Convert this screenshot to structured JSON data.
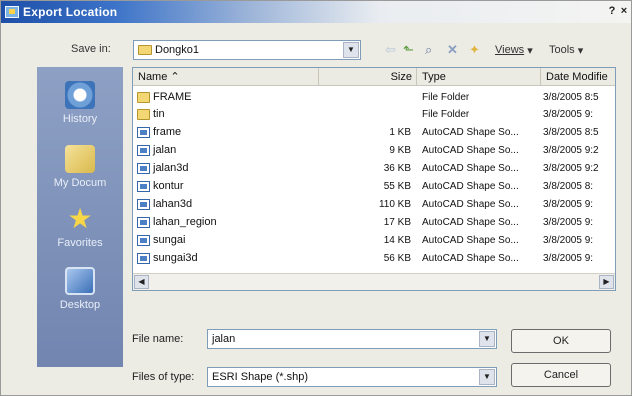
{
  "window": {
    "title": "Export Location",
    "help_label": "?",
    "close_label": "×"
  },
  "toolbar": {
    "save_in_label": "Save in:",
    "save_in_value": "Dongko1",
    "views_label": "Views",
    "tools_label": "Tools"
  },
  "icons": {
    "back": "back-arrow-icon",
    "up": "up-folder-icon",
    "search": "search-web-icon",
    "delete": "delete-icon",
    "new_folder": "new-folder-icon"
  },
  "places": [
    {
      "label": "History",
      "icon": "history-icon"
    },
    {
      "label": "My Docum",
      "icon": "my-documents-icon"
    },
    {
      "label": "Favorites",
      "icon": "favorites-icon"
    },
    {
      "label": "Desktop",
      "icon": "desktop-icon"
    }
  ],
  "columns": {
    "name": "Name",
    "size": "Size",
    "type": "Type",
    "date": "Date Modifie"
  },
  "files": [
    {
      "name": "FRAME",
      "size": "",
      "type": "File Folder",
      "date": "3/8/2005 8:5",
      "kind": "folder"
    },
    {
      "name": "tin",
      "size": "",
      "type": "File Folder",
      "date": "3/8/2005 9:",
      "kind": "folder"
    },
    {
      "name": "frame",
      "size": "1 KB",
      "type": "AutoCAD Shape So...",
      "date": "3/8/2005 8:5",
      "kind": "shape"
    },
    {
      "name": "jalan",
      "size": "9 KB",
      "type": "AutoCAD Shape So...",
      "date": "3/8/2005 9:2",
      "kind": "shape"
    },
    {
      "name": "jalan3d",
      "size": "36 KB",
      "type": "AutoCAD Shape So...",
      "date": "3/8/2005 9:2",
      "kind": "shape"
    },
    {
      "name": "kontur",
      "size": "55 KB",
      "type": "AutoCAD Shape So...",
      "date": "3/8/2005 8:",
      "kind": "shape"
    },
    {
      "name": "lahan3d",
      "size": "110 KB",
      "type": "AutoCAD Shape So...",
      "date": "3/8/2005 9:",
      "kind": "shape"
    },
    {
      "name": "lahan_region",
      "size": "17 KB",
      "type": "AutoCAD Shape So...",
      "date": "3/8/2005 9:",
      "kind": "shape"
    },
    {
      "name": "sungai",
      "size": "14 KB",
      "type": "AutoCAD Shape So...",
      "date": "3/8/2005 9:",
      "kind": "shape"
    },
    {
      "name": "sungai3d",
      "size": "56 KB",
      "type": "AutoCAD Shape So...",
      "date": "3/8/2005 9:",
      "kind": "shape"
    }
  ],
  "form": {
    "file_name_label": "File name:",
    "file_name_value": "jalan",
    "file_type_label": "Files of type:",
    "file_type_value": "ESRI Shape (*.shp)",
    "ok_label": "OK",
    "cancel_label": "Cancel"
  }
}
